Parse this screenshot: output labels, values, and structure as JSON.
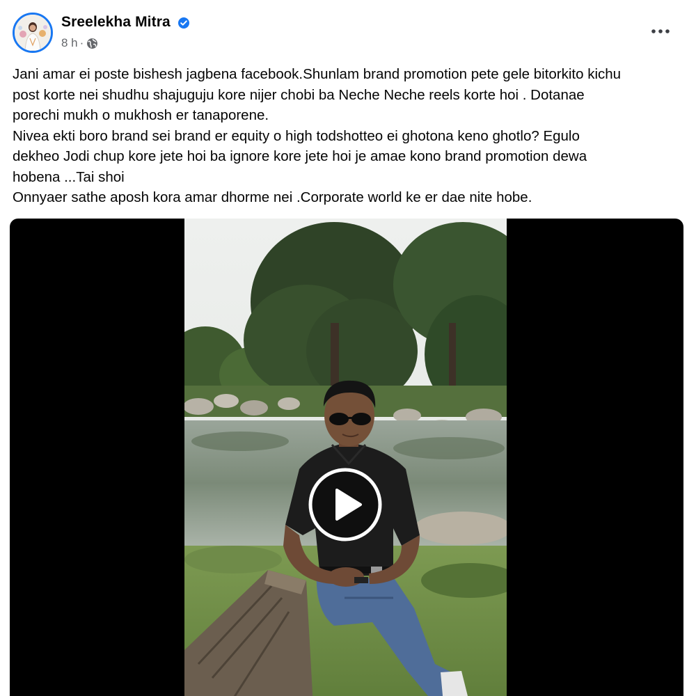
{
  "post": {
    "author": "Sreelekha Mitra",
    "time": "8 h",
    "separator": "·",
    "audience_icon": "globe-icon",
    "verified_icon": "verified-badge-icon",
    "more_icon": "more-horizontal-icon",
    "text": "Jani amar ei poste bishesh jagbena facebook.Shunlam brand promotion pete gele bitorkito kichu\npost korte nei shudhu shajuguju kore nijer chobi ba Neche Neche reels korte hoi . Dotanae\nporechi mukh o mukhosh er tanaporene.\nNivea ekti boro brand sei brand er equity o high todshotteo ei ghotona keno ghotlo? Egulo\ndekheo Jodi chup kore jete hoi ba ignore kore jete hoi je amae kono brand promotion dewa\nhobena ...Tai shoi\nOnnyaer sathe aposh kora amar dhorme nei .Corporate world ke er dae nite hobe."
  },
  "video": {
    "play_icon": "play-icon"
  },
  "colors": {
    "accent": "#1877f2",
    "secondary_text": "#65676b",
    "primary_text": "#050505",
    "video_background": "#000000"
  }
}
